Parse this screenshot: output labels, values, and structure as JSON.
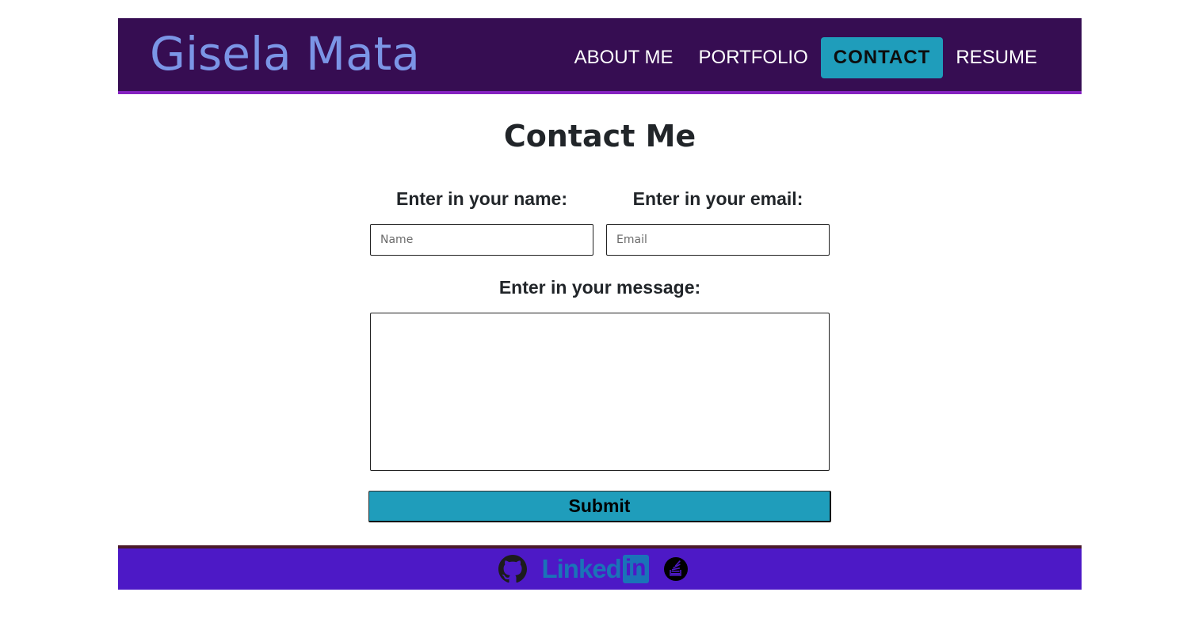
{
  "header": {
    "brand": "Gisela Mata",
    "nav": [
      {
        "label": "ABOUT ME",
        "active": false
      },
      {
        "label": "PORTFOLIO",
        "active": false
      },
      {
        "label": "CONTACT",
        "active": true
      },
      {
        "label": "RESUME",
        "active": false
      }
    ]
  },
  "main": {
    "title": "Contact Me",
    "form": {
      "name_label": "Enter in your name:",
      "name_placeholder": "Name",
      "name_value": "",
      "email_label": "Enter in your email:",
      "email_placeholder": "Email",
      "email_value": "",
      "message_label": "Enter in your message:",
      "message_value": "",
      "submit_label": "Submit"
    }
  },
  "footer": {
    "icons": [
      "github-icon",
      "linkedin-icon",
      "stackoverflow-icon"
    ],
    "linkedin_text": "Linked",
    "linkedin_in": "in"
  },
  "colors": {
    "header_bg": "#360d52",
    "header_border": "#8522c0",
    "brand": "#7b95e6",
    "accent": "#1f9dbb",
    "footer_bg": "#4d19c6",
    "linkedin": "#1a73b8"
  }
}
